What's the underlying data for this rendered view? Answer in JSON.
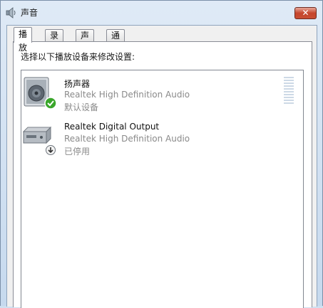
{
  "window": {
    "title": "声音",
    "close_glyph": "✕",
    "icon": "speaker-icon"
  },
  "tabs": [
    {
      "label": "播放",
      "active": true
    },
    {
      "label": "录制",
      "active": false
    },
    {
      "label": "声音",
      "active": false
    },
    {
      "label": "通信",
      "active": false
    }
  ],
  "playback": {
    "instruction": "选择以下播放设备来修改设置:",
    "devices": [
      {
        "name": "扬声器",
        "description": "Realtek High Definition Audio",
        "status": "默认设备",
        "icon": "speaker-device-icon",
        "badge": "default-check-icon",
        "level": 0
      },
      {
        "name": "Realtek Digital Output",
        "description": "Realtek High Definition Audio",
        "status": "已停用",
        "icon": "digital-output-device-icon",
        "badge": "disabled-down-arrow-icon"
      }
    ]
  },
  "colors": {
    "badge_green": "#3aa62b",
    "meter_segment": "#cdd9e6",
    "close_red": "#c5452c"
  }
}
